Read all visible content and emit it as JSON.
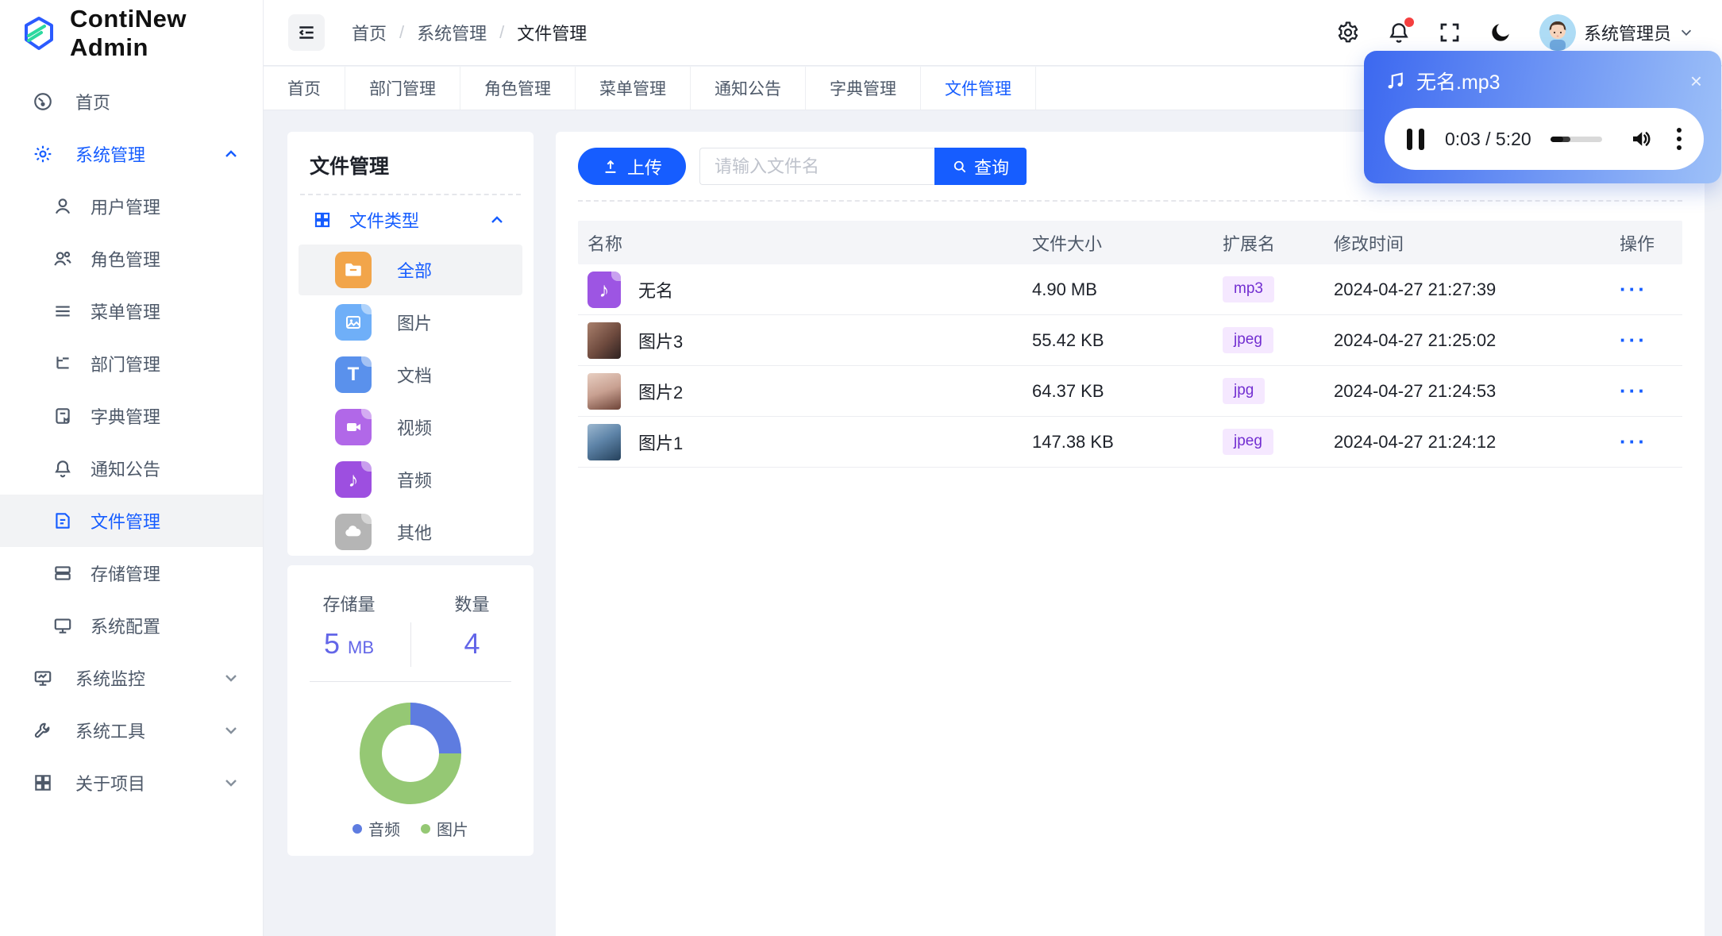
{
  "app": {
    "name": "ContiNew Admin"
  },
  "colors": {
    "accent": "#165DFF",
    "tag_bg": "#F5E8FF",
    "tag_text": "#722ED1",
    "stat_value": "#6366E8",
    "player_grad_start": "#3C68F0",
    "player_grad_end": "#9EC1F8"
  },
  "header": {
    "breadcrumb": [
      "首页",
      "系统管理",
      "文件管理"
    ],
    "user_name": "系统管理员",
    "icon_names": [
      "settings-icon",
      "notification-bell-icon",
      "fullscreen-icon",
      "dark-mode-moon-icon"
    ]
  },
  "audio_player": {
    "title": "无名.mp3",
    "time_display": "0:03 / 5:20",
    "progress_percent": 38,
    "close_label": "×"
  },
  "tabs": [
    {
      "label": "首页"
    },
    {
      "label": "部门管理"
    },
    {
      "label": "角色管理"
    },
    {
      "label": "菜单管理"
    },
    {
      "label": "通知公告"
    },
    {
      "label": "字典管理"
    },
    {
      "label": "文件管理",
      "active": true
    }
  ],
  "sidebar": {
    "items": [
      {
        "label": "首页"
      },
      {
        "label": "系统管理"
      },
      {
        "label": "用户管理"
      },
      {
        "label": "角色管理"
      },
      {
        "label": "菜单管理"
      },
      {
        "label": "部门管理"
      },
      {
        "label": "字典管理"
      },
      {
        "label": "通知公告"
      },
      {
        "label": "文件管理"
      },
      {
        "label": "存储管理"
      },
      {
        "label": "系统配置"
      },
      {
        "label": "系统监控"
      },
      {
        "label": "系统工具"
      },
      {
        "label": "关于项目"
      }
    ]
  },
  "file_panel": {
    "title": "文件管理",
    "group_label": "文件类型",
    "types": [
      {
        "label": "全部",
        "color": "#F2A54A"
      },
      {
        "label": "图片",
        "color": "#6FAFF8"
      },
      {
        "label": "文档",
        "color": "#5A91EC"
      },
      {
        "label": "视频",
        "color": "#B168E8"
      },
      {
        "label": "音频",
        "color": "#9D4FE0"
      },
      {
        "label": "其他",
        "color": "#B5B5B5"
      }
    ]
  },
  "storage_panel": {
    "storage_label": "存储量",
    "storage_value": "5",
    "storage_unit": "MB",
    "count_label": "数量",
    "count_value": "4"
  },
  "chart_data": {
    "type": "pie",
    "labels": [
      "音频",
      "图片"
    ],
    "values": [
      1,
      3
    ],
    "colors": [
      "#5E7CE0",
      "#95C874"
    ],
    "legend_position": "bottom"
  },
  "toolbar": {
    "upload_label": "上传",
    "search_placeholder": "请输入文件名",
    "search_label": "查询"
  },
  "table": {
    "columns": [
      "名称",
      "文件大小",
      "扩展名",
      "修改时间",
      "操作"
    ],
    "rows": [
      {
        "name": "无名",
        "size": "4.90 MB",
        "ext": "mp3",
        "time": "2024-04-27 21:27:39",
        "thumb": "audio",
        "actions": "···"
      },
      {
        "name": "图片3",
        "size": "55.42 KB",
        "ext": "jpeg",
        "time": "2024-04-27 21:25:02",
        "thumb": "photo-warm",
        "actions": "···"
      },
      {
        "name": "图片2",
        "size": "64.37 KB",
        "ext": "jpg",
        "time": "2024-04-27 21:24:53",
        "thumb": "photo-pink",
        "actions": "···"
      },
      {
        "name": "图片1",
        "size": "147.38 KB",
        "ext": "jpeg",
        "time": "2024-04-27 21:24:12",
        "thumb": "photo-blue",
        "actions": "···"
      }
    ]
  }
}
